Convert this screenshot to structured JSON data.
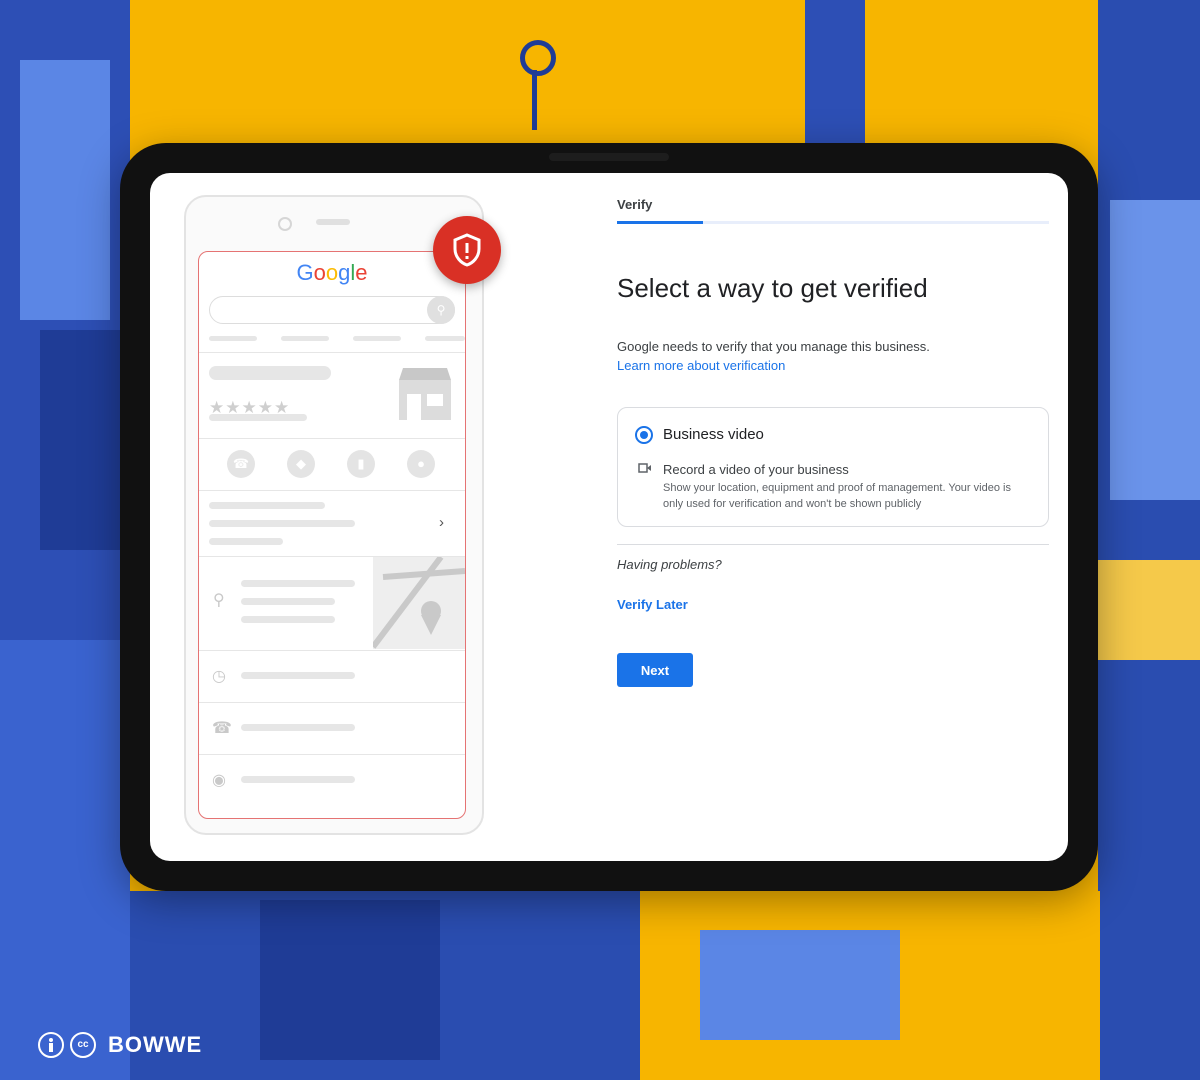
{
  "phone_mockup": {
    "google_logo": [
      {
        "ch": "G",
        "color": "#4285f4"
      },
      {
        "ch": "o",
        "color": "#ea4335"
      },
      {
        "ch": "o",
        "color": "#fbbc05"
      },
      {
        "ch": "g",
        "color": "#4285f4"
      },
      {
        "ch": "l",
        "color": "#34a853"
      },
      {
        "ch": "e",
        "color": "#ea4335"
      }
    ],
    "stars": "★★★★★",
    "icons": [
      "phone-icon",
      "directions-icon",
      "bookmark-icon",
      "globe-icon",
      "pin-icon",
      "clock-icon",
      "store-icon",
      "shield-alert-icon"
    ]
  },
  "verify": {
    "step_label": "Verify",
    "progress_fraction": 0.2,
    "heading": "Select a way to get verified",
    "intro": "Google needs to verify that you manage this business.",
    "learn_more": "Learn more about verification",
    "option": {
      "title": "Business video",
      "subtitle": "Record a video of your business",
      "description": "Show your location, equipment and proof of management. Your video is only used for verification and won't be shown publicly",
      "selected": true
    },
    "problems": "Having problems?",
    "verify_later": "Verify Later",
    "next": "Next"
  },
  "brand": {
    "name": "BOWWE",
    "cc_label": "cc"
  },
  "colors": {
    "primary": "#1a73e8",
    "alert": "#d93025",
    "background": "#f7b500",
    "accent_blue": "#2d4fb5"
  }
}
